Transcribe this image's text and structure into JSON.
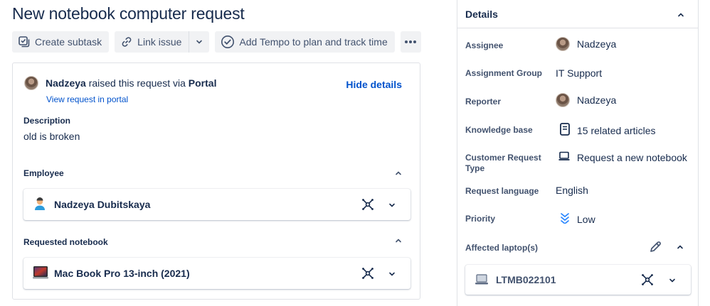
{
  "issue": {
    "title": "New notebook computer request"
  },
  "toolbar": {
    "create_subtask": "Create subtask",
    "link_issue": "Link issue",
    "tempo": "Add Tempo to plan and track time"
  },
  "request": {
    "raiser": "Nadzeya",
    "raised_text": "raised this request via",
    "channel": "Portal",
    "hide_details": "Hide details",
    "view_portal": "View request in portal",
    "description_label": "Description",
    "description": "old is broken",
    "employee_label": "Employee",
    "employee_name": "Nadzeya Dubitskaya",
    "notebook_label": "Requested notebook",
    "notebook_name": "Mac Book Pro 13-inch (2021)"
  },
  "details": {
    "title": "Details",
    "assignee_label": "Assignee",
    "assignee": "Nadzeya",
    "group_label": "Assignment Group",
    "group": "IT Support",
    "reporter_label": "Reporter",
    "reporter": "Nadzeya",
    "kb_label": "Knowledge base",
    "kb": "15 related articles",
    "crt_label": "Customer Request Type",
    "crt": "Request a new notebook",
    "lang_label": "Request language",
    "lang": "English",
    "priority_label": "Priority",
    "priority": "Low",
    "affected_label": "Affected laptop(s)",
    "laptop": "LTMB022101"
  },
  "colors": {
    "link": "#0052cc",
    "text": "#172b4d",
    "subtle": "#42526e",
    "priority_low": "#2684ff"
  }
}
